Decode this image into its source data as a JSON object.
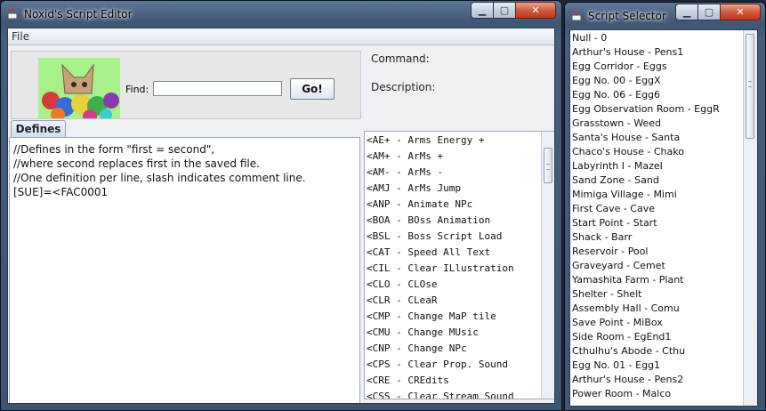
{
  "editor": {
    "title": "Noxid's Script Editor",
    "menu_file": "File",
    "find_label": "Find:",
    "find_value": "",
    "go_label": "Go!",
    "command_label": "Command:",
    "description_label": "Description:",
    "tab_defines": "Defines",
    "defines_lines": [
      "//Defines in the form \"first = second\",",
      "//where second replaces first in the saved file.",
      "//One definition per line, slash indicates comment line.",
      "[SUE]=<FAC0001"
    ],
    "commands": [
      "<AE+ - Arms Energy +",
      "<AM+ - ArMs +",
      "<AM- - ArMs -",
      "<AMJ - ArMs Jump",
      "<ANP - Animate NPc",
      "<BOA - BOss Animation",
      "<BSL - Boss Script Load",
      "<CAT - Speed All Text",
      "<CIL - Clear ILlustration",
      "<CLO - CLOse",
      "<CLR - CLeaR",
      "<CMP - Change MaP tile",
      "<CMU - Change MUsic",
      "<CNP - Change NPc",
      "<CPS - Clear Prop. Sound",
      "<CRE - CREdits",
      "<CSS - Clear Stream Sound"
    ]
  },
  "selector": {
    "title": "Script Selector",
    "items": [
      "Null - 0",
      "Arthur's House - Pens1",
      "Egg Corridor - Eggs",
      "Egg No. 00 - EggX",
      "Egg No. 06 - Egg6",
      "Egg Observation Room - EggR",
      "Grasstown - Weed",
      "Santa's House - Santa",
      "Chaco's House - Chako",
      "Labyrinth I - MazeI",
      "Sand Zone - Sand",
      "Mimiga Village - Mimi",
      "First Cave - Cave",
      "Start Point - Start",
      "Shack - Barr",
      "Reservoir - Pool",
      "Graveyard - Cemet",
      "Yamashita Farm - Plant",
      "Shelter - Shelt",
      "Assembly Hall - Comu",
      "Save Point - MiBox",
      "Side Room - EgEnd1",
      "Cthulhu's Abode - Cthu",
      "Egg No. 01 - Egg1",
      "Arthur's House - Pens2",
      "Power Room - Malco"
    ]
  },
  "controls": {
    "minimize": "▁",
    "maximize": "▢",
    "close": "✕"
  },
  "colors": {
    "title_bar": "#4a6383",
    "close_button": "#c94a2c",
    "list_bg": "#ffffff"
  }
}
